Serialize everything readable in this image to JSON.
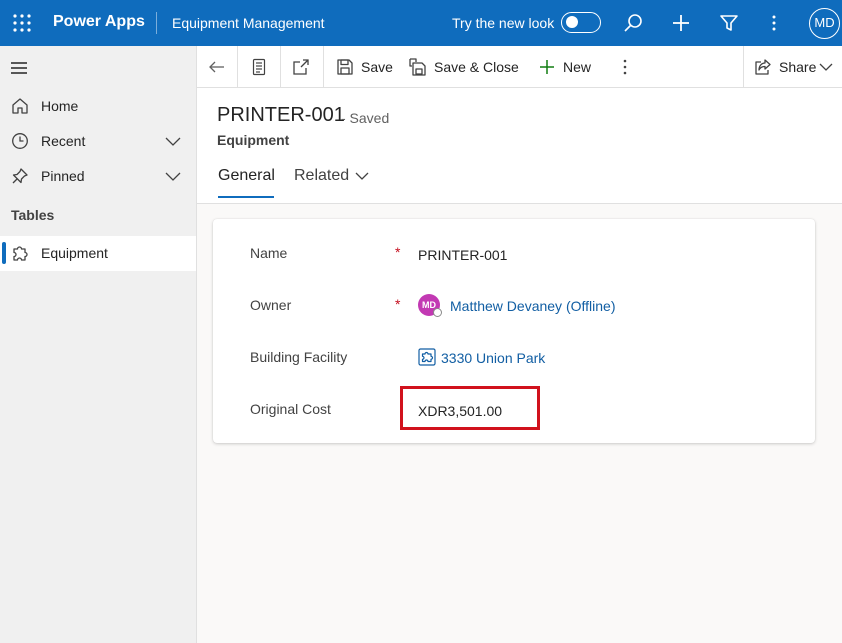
{
  "topbar": {
    "app_name": "Power Apps",
    "environment": "Equipment Management",
    "try_new_look": "Try the new look",
    "user_initials": "MD",
    "bg_color": "#0f6cbd"
  },
  "sidebar": {
    "items": [
      {
        "label": "Home",
        "icon": "home-icon"
      },
      {
        "label": "Recent",
        "icon": "clock-icon"
      },
      {
        "label": "Pinned",
        "icon": "pin-icon"
      }
    ],
    "section": "Tables",
    "tables": [
      {
        "label": "Equipment",
        "icon": "puzzle-icon",
        "active": true
      }
    ]
  },
  "commandbar": {
    "save": "Save",
    "save_close": "Save & Close",
    "new": "New",
    "share": "Share"
  },
  "record": {
    "title": "PRINTER-001",
    "status": "- Saved",
    "entity": "Equipment",
    "tabs": {
      "general": "General",
      "related": "Related"
    }
  },
  "form": {
    "fields": [
      {
        "label": "Name",
        "value": "PRINTER-001",
        "required": true
      },
      {
        "label": "Owner",
        "value": "Matthew Devaney (Offline)",
        "required": true,
        "avatar_initials": "MD"
      },
      {
        "label": "Building Facility",
        "value": "3330 Union Park",
        "required": false
      },
      {
        "label": "Original Cost",
        "value": "XDR3,501.00",
        "required": false
      }
    ]
  }
}
